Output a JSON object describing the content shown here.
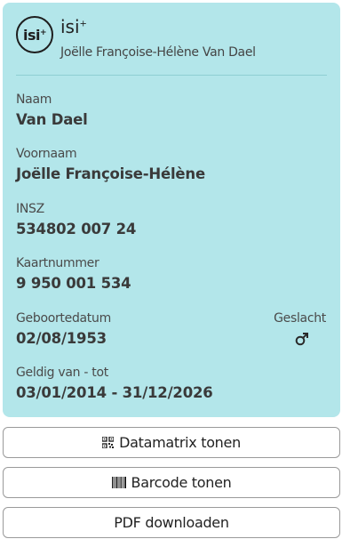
{
  "card": {
    "logo_text": "isi",
    "logo_sup": "+",
    "brand_name": "isi",
    "brand_sup": "+",
    "holder_name": "Joëlle Françoise-Hélène Van Dael",
    "accent_color": "#b3e6ea"
  },
  "fields": {
    "naam": {
      "label": "Naam",
      "value": "Van Dael"
    },
    "voornaam": {
      "label": "Voornaam",
      "value": "Joëlle Françoise-Hélène"
    },
    "insz": {
      "label": "INSZ",
      "value": "534802 007 24"
    },
    "kaartnummer": {
      "label": "Kaartnummer",
      "value": "9 950 001 534"
    },
    "geboortedatum": {
      "label": "Geboortedatum",
      "value": "02/08/1953"
    },
    "geslacht": {
      "label": "Geslacht",
      "icon": "male-symbol-icon"
    },
    "geldig": {
      "label": "Geldig van - tot",
      "value": "03/01/2014 - 31/12/2026"
    }
  },
  "buttons": {
    "datamatrix": {
      "label": "Datamatrix tonen",
      "icon": "qr-code-icon"
    },
    "barcode": {
      "label": "Barcode tonen",
      "icon": "barcode-icon"
    },
    "pdf": {
      "label": "PDF downloaden"
    }
  }
}
